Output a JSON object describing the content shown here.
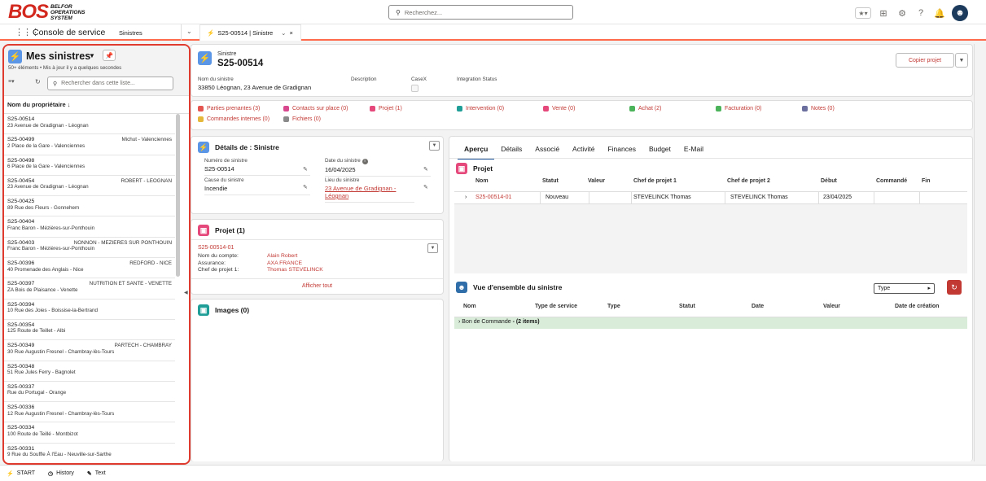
{
  "brand": {
    "logo": "BOS",
    "line1": "BELFOR",
    "line2": "OPERATIONS",
    "line3": "SYSTEM"
  },
  "search": {
    "placeholder": "Recherchez..."
  },
  "nav": {
    "app_name": "Console de service",
    "item": "Sinistres",
    "tab_label": "S25-00514 | Sinistre"
  },
  "list_view": {
    "title": "Mes sinistres",
    "meta": "50+ éléments • Mis à jour il y a quelques secondes",
    "search_placeholder": "Rechercher dans cette liste...",
    "column_header": "Nom du propriétaire",
    "items": [
      {
        "num": "S25-00514",
        "addr": "23 Avenue de Gradignan - Léognan",
        "owner": ""
      },
      {
        "num": "S25-00499",
        "addr": "2 Place de la Gare - Valenciennes",
        "owner": "Michut - Valenciennes"
      },
      {
        "num": "S25-00498",
        "addr": "6 Place de la Gare - Valenciennes",
        "owner": ""
      },
      {
        "num": "S25-00454",
        "addr": "23 Avenue de Gradignan - Léognan",
        "owner": "ROBERT - LEOGNAN"
      },
      {
        "num": "S25-00425",
        "addr": "89 Rue des Fleurs - Gonnehem",
        "owner": ""
      },
      {
        "num": "S25-00404",
        "addr": "Franc Baron - Mézières-sur-Ponthouin",
        "owner": ""
      },
      {
        "num": "S25-00403",
        "addr": "Franc Baron - Mézières-sur-Ponthouin",
        "owner": "NONNON - MEZIERES SUR PONTHOUIN"
      },
      {
        "num": "S25-00396",
        "addr": "40 Promenade des Anglais - Nice",
        "owner": "REDFORD - NICE"
      },
      {
        "num": "S25-00397",
        "addr": "ZA Bois de Plaisance - Venette",
        "owner": "NUTRITION ET SANTE - VENETTE"
      },
      {
        "num": "S25-00394",
        "addr": "10 Rue des Joies - Boissise-la-Bertrand",
        "owner": ""
      },
      {
        "num": "S25-00354",
        "addr": "125 Route de Teillet - Albi",
        "owner": ""
      },
      {
        "num": "S25-00349",
        "addr": "30 Rue Augustin Fresnel - Chambray-lès-Tours",
        "owner": "PARTECH - CHAMBRAY"
      },
      {
        "num": "S25-00348",
        "addr": "51 Rue Jules Ferry - Bagnolet",
        "owner": ""
      },
      {
        "num": "S25-00337",
        "addr": "Rue du Portugal - Orange",
        "owner": ""
      },
      {
        "num": "S25-00336",
        "addr": "12 Rue Augustin Fresnel - Chambray-lès-Tours",
        "owner": ""
      },
      {
        "num": "S25-00334",
        "addr": "100 Route de Teillé - Montbizot",
        "owner": ""
      },
      {
        "num": "S25-00331",
        "addr": "9 Rue du Souffle À l'Eau - Neuville-sur-Sarthe",
        "owner": ""
      }
    ]
  },
  "record": {
    "type": "Sinistre",
    "name": "S25-00514",
    "copy_button": "Copier projet",
    "fields": {
      "nom_label": "Nom du sinistre",
      "nom_value": "33850 Léognan, 23 Avenue de Gradignan",
      "description_label": "Description",
      "casex_label": "CaseX",
      "integration_label": "Integration Status"
    }
  },
  "related": [
    {
      "label": "Parties prenantes (3)",
      "color": "#e5554f"
    },
    {
      "label": "Contacts sur place (0)",
      "color": "#d8488f"
    },
    {
      "label": "Projet (1)",
      "color": "#e5487a"
    },
    {
      "label": "Intervention (0)",
      "color": "#1f9e97"
    },
    {
      "label": "Vente (0)",
      "color": "#e5487a"
    },
    {
      "label": "Achat (2)",
      "color": "#4bb35a"
    },
    {
      "label": "Facturation (0)",
      "color": "#4bb35a"
    },
    {
      "label": "Notes (0)",
      "color": "#6b6f9e"
    },
    {
      "label": "Commandes internes (0)",
      "color": "#e5b73b"
    },
    {
      "label": "Fichiers (0)",
      "color": "#8a8a8a"
    }
  ],
  "details": {
    "title": "Détails de : Sinistre",
    "numero_label": "Numéro de sinistre",
    "numero_value": "S25-00514",
    "date_label": "Date du sinistre",
    "date_value": "16/04/2025",
    "cause_label": "Cause du sinistre",
    "cause_value": "Incendie",
    "lieu_label": "Lieu du sinistre",
    "lieu_value": "23 Avenue de Gradignan - Léognan"
  },
  "projet_card": {
    "title": "Projet (1)",
    "record": "S25-00514-01",
    "compte_label": "Nom du compte:",
    "compte_value": "Alain Robert",
    "assurance_label": "Assurance:",
    "assurance_value": "AXA FRANCE",
    "chef_label": "Chef de projet 1:",
    "chef_value": "Thomas STEVELINCK",
    "show_all": "Afficher tout"
  },
  "images_card": {
    "title": "Images (0)"
  },
  "tabs": [
    "Aperçu",
    "Détails",
    "Associé",
    "Activité",
    "Finances",
    "Budget",
    "E-Mail"
  ],
  "projet_table": {
    "title": "Projet",
    "headers": {
      "nom": "Nom",
      "statut": "Statut",
      "valeur": "Valeur",
      "chef1": "Chef de projet 1",
      "chef2": "Chef de projet 2",
      "debut": "Début",
      "commande": "Commandé",
      "fin": "Fin"
    },
    "row": {
      "nom": "S25-00514-01",
      "statut": "Nouveau",
      "valeur": "",
      "chef1": "STEVELINCK Thomas",
      "chef2": "STEVELINCK Thomas",
      "debut": "23/04/2025",
      "commande": "",
      "fin": ""
    }
  },
  "overview": {
    "title": "Vue d'ensemble du sinistre",
    "type_select": "Type",
    "headers": {
      "nom": "Nom",
      "type_service": "Type de service",
      "type": "Type",
      "statut": "Statut",
      "date": "Date",
      "valeur": "Valeur",
      "creation": "Date de création"
    },
    "group_label": "Bon de Commande",
    "group_count": "- (2 items)"
  },
  "bottom": {
    "start": "START",
    "history": "History",
    "text": "Text"
  },
  "colors": {
    "accent_red": "#c23934",
    "brand_red": "#d2281e",
    "icon_blue": "#5a95e6",
    "nav_underline": "#ff6a4d",
    "group_green": "#d8ecd9"
  }
}
